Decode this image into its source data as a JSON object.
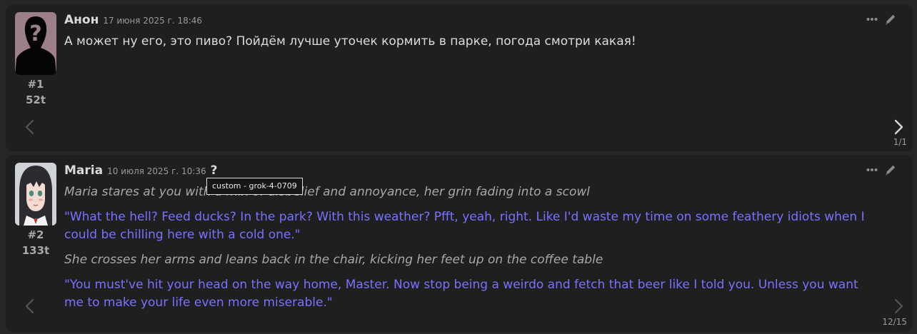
{
  "messages": [
    {
      "name": "Анон",
      "timestamp": "17 июня 2025 г. 18:46",
      "id": "#1",
      "tokens": "52t",
      "text": "А может ну его, это пиво? Пойдём лучше уточек кормить в парке, погода смотри какая!",
      "swipe_counter": "1/1",
      "avatar_icon": "user-silhouette-icon"
    },
    {
      "name": "Maria",
      "timestamp": "10 июля 2025 г. 10:36",
      "model_info_icon": "?",
      "tooltip": "custom - grok-4-0709",
      "id": "#2",
      "tokens": "133t",
      "paragraphs": [
        "Maria stares at you with a mix of disbelief and annoyance, her grin fading into a scowl",
        "\"What the hell? Feed ducks? In the park? With this weather? Pfft, yeah, right. Like I'd waste my time on some feathery idiots when I could be chilling here with a cold one.\"",
        "She crosses her arms and leans back in the chair, kicking her feet up on the coffee table",
        "\"You must've hit your head on the way home, Master. Now stop being a weirdo and fetch that beer like I told you. Unless you want me to make your life even more miserable.\""
      ],
      "swipe_counter": "12/15",
      "avatar_icon": "character-portrait-icon"
    }
  ],
  "colors": {
    "background": "#262626",
    "message_bg": "#1f1f1f",
    "name": "#dadada",
    "narration": "#a8a8a8",
    "quote": "#7a72ff",
    "user_avatar_bg": "#9c7f8a"
  },
  "icons": {
    "more": "ellipsis-icon",
    "edit": "pencil-icon",
    "swipe_left": "chevron-left-icon",
    "swipe_right": "chevron-right-icon"
  }
}
